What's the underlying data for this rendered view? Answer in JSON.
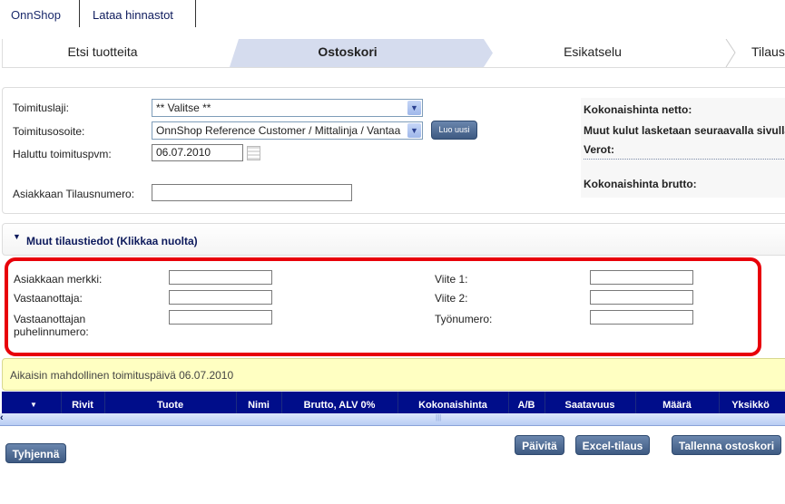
{
  "top_tabs": [
    {
      "label": "OnnShop"
    },
    {
      "label": "Lataa hinnastot"
    }
  ],
  "steps": [
    {
      "label": "Etsi tuotteita"
    },
    {
      "label": "Ostoskori",
      "active": true
    },
    {
      "label": "Esikatselu"
    },
    {
      "label": "Tilaus"
    }
  ],
  "delivery": {
    "type_label": "Toimituslaji:",
    "type_value": "** Valitse **",
    "address_label": "Toimitusosoite:",
    "address_value": "OnnShop Reference Customer / Mittalinja / Vantaa",
    "new_button": "Luo uusi",
    "date_label": "Haluttu toimituspvm:",
    "date_value": "06.07.2010",
    "order_no_label": "Asiakkaan Tilausnumero:",
    "order_no_value": ""
  },
  "summary": {
    "net": "Kokonaishinta netto:",
    "other_costs": "Muut kulut lasketaan seuraavalla sivulla",
    "taxes": "Verot:",
    "gross": "Kokonaishinta brutto:"
  },
  "other_info": {
    "toggle_label": "Muut tilaustiedot (Klikkaa nuolta)",
    "fields_left": [
      {
        "label": "Asiakkaan merkki:",
        "value": ""
      },
      {
        "label": "Vastaanottaja:",
        "value": ""
      },
      {
        "label": "Vastaanottajan puhelinnumero:",
        "value": ""
      }
    ],
    "fields_right": [
      {
        "label": "Viite 1:",
        "value": ""
      },
      {
        "label": "Viite 2:",
        "value": ""
      },
      {
        "label": "Työnumero:",
        "value": ""
      }
    ]
  },
  "notice": "Aikaisin mahdollinen toimituspäivä 06.07.2010",
  "table": {
    "columns": [
      "Rivit",
      "Tuote",
      "Nimi",
      "Brutto, ALV 0%",
      "Kokonaishinta",
      "A/B",
      "Saatavuus",
      "Määrä",
      "Yksikkö"
    ]
  },
  "buttons": {
    "clear": "Tyhjennä",
    "update": "Päivitä",
    "excel": "Excel-tilaus",
    "save": "Tallenna ostoskori"
  },
  "colors": {
    "highlight": "#e8000a",
    "table_header": "#000d8a",
    "notice_bg": "#ffffc2",
    "button": "#4a6890"
  }
}
